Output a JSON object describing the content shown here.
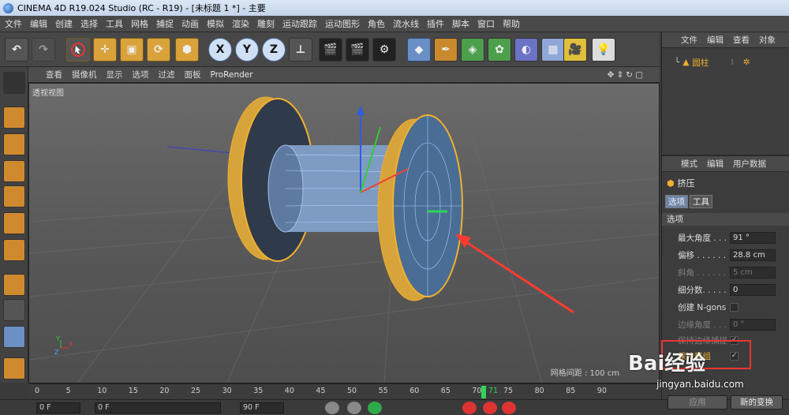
{
  "window": {
    "title": "CINEMA 4D R19.024 Studio (RC - R19) - [未标题 1 *] - 主要"
  },
  "menubar": [
    "文件",
    "编辑",
    "创建",
    "选择",
    "工具",
    "网格",
    "捕捉",
    "动画",
    "模拟",
    "渲染",
    "雕刻",
    "运动跟踪",
    "运动图形",
    "角色",
    "流水线",
    "插件",
    "脚本",
    "窗口",
    "帮助"
  ],
  "toolbar": {
    "axis_x": "X",
    "axis_y": "Y",
    "axis_z": "Z"
  },
  "viewport": {
    "menu": [
      "查看",
      "摄像机",
      "显示",
      "选项",
      "过滤",
      "面板",
      "ProRender"
    ],
    "label": "透视视图",
    "grid_spacing": "网格间距 : 100 cm"
  },
  "object_manager": {
    "menu": [
      "文件",
      "编辑",
      "查看",
      "对象"
    ],
    "object_name": "圆柱"
  },
  "attribute_manager": {
    "menu": [
      "模式",
      "编辑",
      "用户数据"
    ],
    "object_name": "挤压",
    "tabs": [
      "选项",
      "工具"
    ],
    "section": "选项",
    "props": [
      {
        "label": "最大角度 . . .",
        "value": "91 °"
      },
      {
        "label": "偏移 . . . . . .",
        "value": "28.8 cm"
      },
      {
        "label": "斜角 . . . . . .",
        "value": "5 cm"
      },
      {
        "label": "细分数. . . . .",
        "value": "0"
      },
      {
        "label": "创建 N-gons",
        "value": ""
      },
      {
        "label": "边缘角度 . . .",
        "value": "0 °"
      },
      {
        "label": "保持边缘捕捉",
        "value": "✓"
      },
      {
        "label": "保持群组",
        "value": "✓"
      }
    ],
    "apply_label": "应用",
    "new_transform_label": "新的变换"
  },
  "timeline": {
    "ticks": [
      "0",
      "5",
      "10",
      "15",
      "20",
      "25",
      "30",
      "35",
      "40",
      "45",
      "50",
      "55",
      "60",
      "65",
      "70",
      "75",
      "80",
      "85",
      "90"
    ],
    "current_frame": "71",
    "start_field": "0 F",
    "min_field": "0 F",
    "max_field": "90 F"
  },
  "watermark": {
    "logo_text": "Bai经验",
    "url": "jingyan.baidu.com"
  },
  "colors": {
    "accent_orange": "#d9a23a",
    "arrow_red": "#ff3b30",
    "playhead_green": "#2fd45a"
  }
}
